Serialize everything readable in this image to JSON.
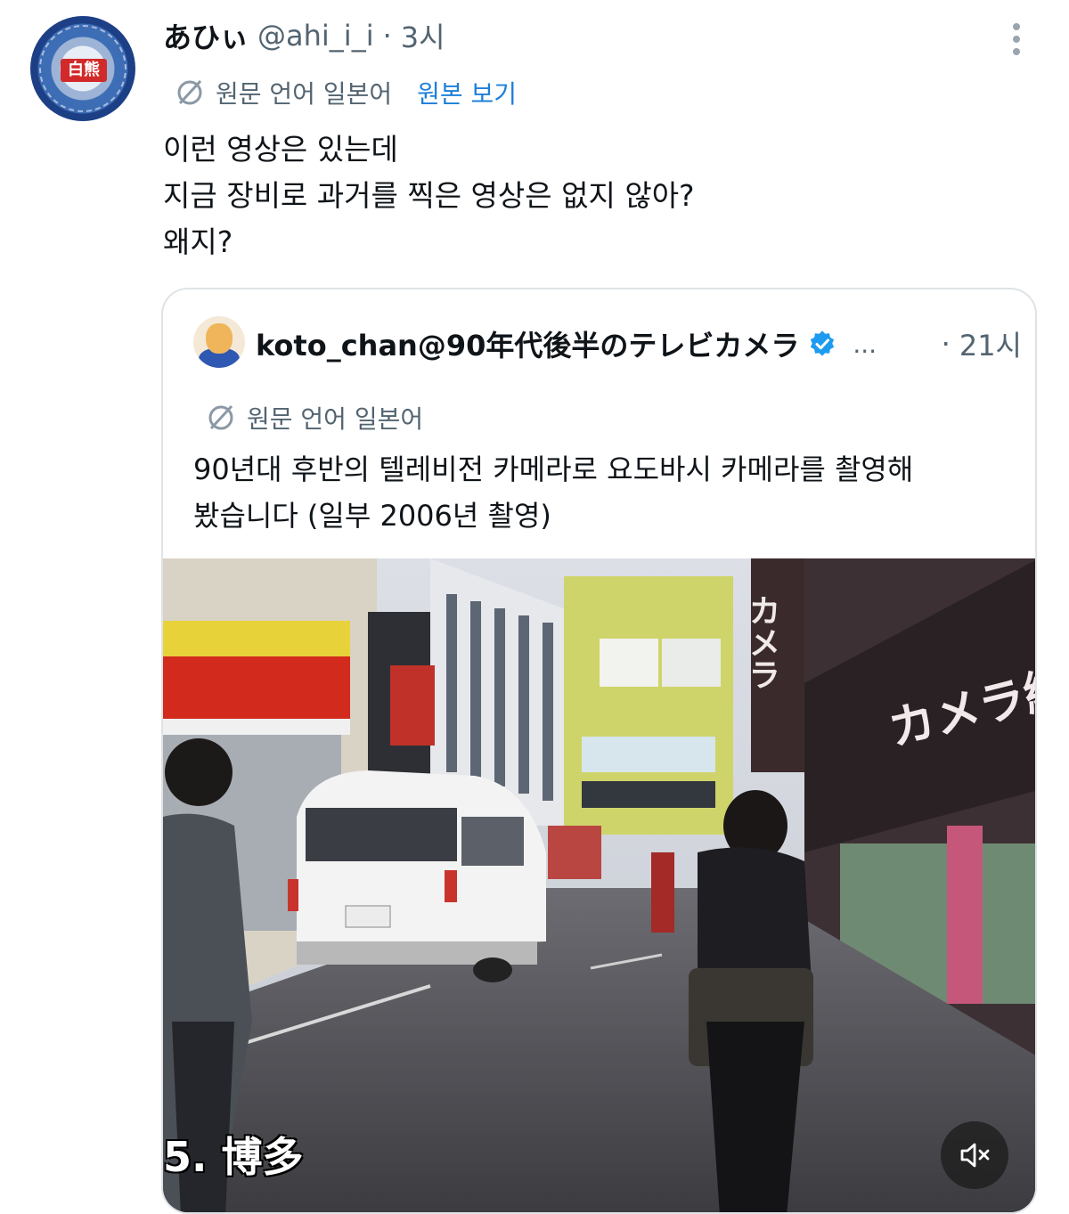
{
  "post": {
    "display_name": "あひぃ",
    "handle": "@ahi_i_i",
    "separator": "·",
    "time": "3시",
    "translation": {
      "label": "원문 언어 일본어",
      "show_original": "원본 보기"
    },
    "text_lines": [
      "이런 영상은 있는데",
      "지금 장비로 과거를 찍은 영상은 없지 않아?",
      "왜지?"
    ],
    "avatar_badge": "白熊"
  },
  "quote": {
    "display_name": "koto_chan@90年代後半のテレビカメラ",
    "ellipsis": "...",
    "separator": "·",
    "time": "21시",
    "translation": {
      "label": "원문 언어 일본어"
    },
    "text_lines": [
      "90년대 후반의 텔레비전 카메라로 요도바시 카메라를 촬영해",
      "봤습니다 (일부 2006년 촬영)"
    ],
    "media": {
      "caption": "5. 博多",
      "signs": [
        "カメラ",
        "カメラ総"
      ]
    }
  },
  "icons": {
    "translate": "translate-icon",
    "more": "more-options-icon",
    "verified": "verified-badge-icon",
    "mute": "volume-muted-icon"
  },
  "colors": {
    "link": "#1d7fd8",
    "verified": "#1d9bf0",
    "secondary_text": "#536471",
    "border": "#dfe3e6"
  }
}
